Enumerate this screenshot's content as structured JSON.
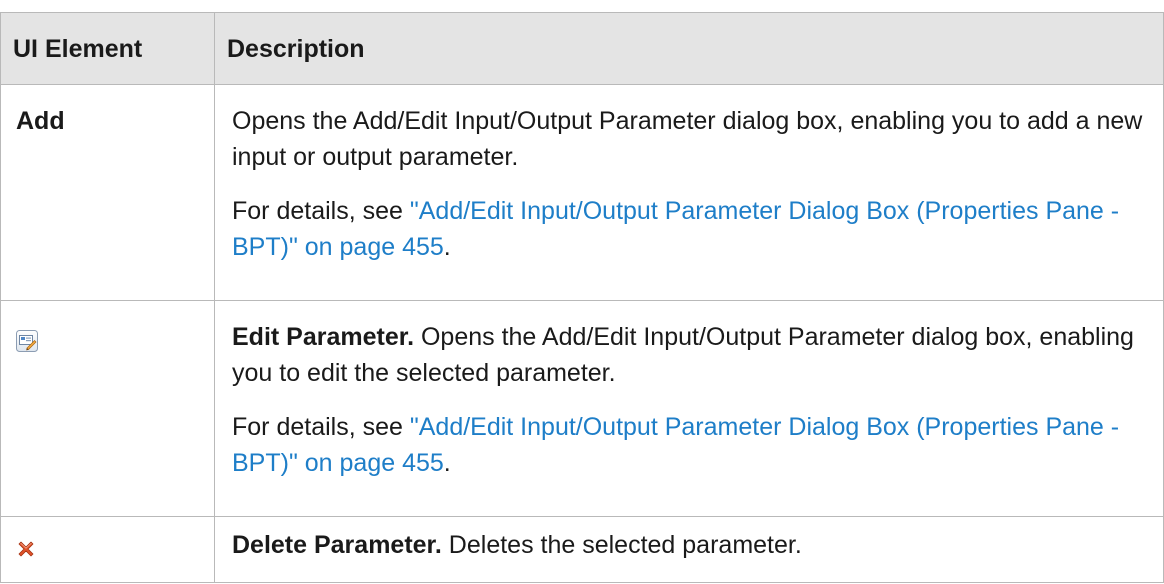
{
  "table": {
    "header": {
      "ui_element": "UI Element",
      "description": "Description"
    },
    "rows": [
      {
        "element_label": "Add",
        "element_icon": null,
        "lead": "",
        "paragraphs": [
          {
            "text": "Opens the Add/Edit Input/Output Parameter dialog box, enabling you to add a new input or output parameter."
          },
          {
            "prefix": "For details, see ",
            "link": "\"Add/Edit Input/Output Parameter Dialog Box (Properties Pane - BPT)\" on page 455",
            "suffix": "."
          }
        ]
      },
      {
        "element_label": "",
        "element_icon": "edit-parameter-icon",
        "lead": "Edit Parameter.",
        "paragraphs": [
          {
            "text": " Opens the Add/Edit Input/Output Parameter dialog box, enabling you to edit the selected parameter."
          },
          {
            "prefix": "For details, see ",
            "link": "\"Add/Edit Input/Output Parameter Dialog Box (Properties Pane - BPT)\" on page 455",
            "suffix": "."
          }
        ]
      },
      {
        "element_label": "",
        "element_icon": "delete-parameter-icon",
        "lead": "Delete Parameter.",
        "paragraphs": [
          {
            "text": " Deletes the selected parameter."
          }
        ]
      }
    ]
  },
  "colors": {
    "header_bg": "#e4e4e4",
    "border": "#b9b9b9",
    "link": "#1e7ec8",
    "delete_icon": "#d9431f"
  }
}
